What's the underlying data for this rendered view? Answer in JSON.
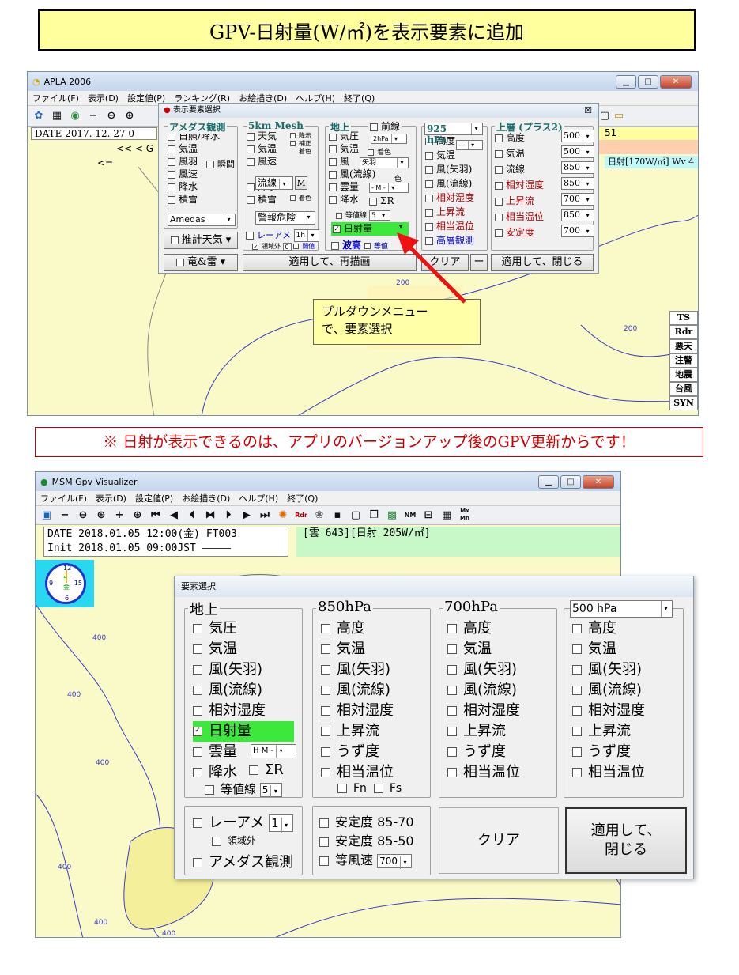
{
  "banner": {
    "text": "GPV-日射量(W/㎡)を表示要素に追加"
  },
  "notice": {
    "text": "※ 日射が表示できるのは、アプリのバージョンアップ後のGPV更新からです！"
  },
  "win1": {
    "title": "APLA 2006",
    "menu": [
      "ファイル(F)",
      "表示(D)",
      "設定値(P)",
      "ランキング(R)",
      "お絵描き(D)",
      "ヘルプ(H)",
      "終了(Q)"
    ],
    "date_text": "DATE 2017. 12. 27",
    "date_suffix": "0",
    "right_text": "51",
    "right_text2": "日射[170W/㎡] Wv 4",
    "nav1": "<< < G",
    "nav2": "<=",
    "contour": "200",
    "contour2": "200",
    "side_buttons": [
      "TS",
      "Rdr",
      "悪天",
      "注警",
      "地震",
      "台風",
      "SYN"
    ],
    "callout": "プルダウンメニュー\nで、要素選択",
    "dialog": {
      "title": "表示要素選択",
      "close": "☒",
      "amedas": {
        "legend": "アメダス観測",
        "items": [
          "日照/降水",
          "気温",
          "風羽",
          "風速",
          "降水",
          "積雪"
        ],
        "extra": "瞬間",
        "select": "Amedas"
      },
      "mesh": {
        "legend": "5km Mesh",
        "items": [
          "天気",
          "気温",
          "風速",
          "流線",
          "降水",
          "積雪"
        ],
        "notes": [
          "降示",
          "補正",
          "着色",
          "着色"
        ],
        "m_btn": "M",
        "select": "警報危険",
        "rader": "レーアメ",
        "rader_sel": "1h",
        "kiki": "領域外",
        "kiki_v": "0",
        "kiki2": "閾値"
      },
      "surface": {
        "legend": "地上",
        "sub": "前線",
        "items": [
          "気圧",
          "気温",
          "風",
          "風(流線)",
          "雲量",
          "降水"
        ],
        "pres_sel": "2hPa",
        "chakushoku": "着色",
        "wind_sel": "矢羽",
        "iro": "色",
        "cloud_sel": "- M -",
        "sigma": "ΣR",
        "contour": "等値線",
        "contour_v": "5",
        "sun": "日射量",
        "wave": "波高",
        "toukou": "等値"
      },
      "hpa925": {
        "select": "925 hPa",
        "items": [
          "高度",
          "気温",
          "風(矢羽)",
          "風(流線)",
          "相対湿度",
          "上昇流",
          "相当温位",
          "高層観測"
        ],
        "h_sel": "---"
      },
      "upper": {
        "legend": "上層 (プラス2)",
        "items": [
          "高度",
          "気温",
          "流線",
          "相対湿度",
          "上昇流",
          "相当温位",
          "安定度"
        ],
        "vals": [
          "500",
          "500",
          "850",
          "850",
          "700",
          "850",
          "700"
        ]
      },
      "b_suii": "推計天気",
      "b_tatsu": "竜&雷",
      "b_apply": "適用して、再描画",
      "b_clear": "クリア",
      "b_minus": "ー",
      "b_close": "適用して、閉じる"
    }
  },
  "win2": {
    "title": "MSM Gpv Visualizer",
    "menu": [
      "ファイル(F)",
      "表示(D)",
      "設定値(P)",
      "お絵描き(D)",
      "ヘルプ(H)",
      "終了(Q)"
    ],
    "date_line": "DATE 2018.01.05 12:00(金) FT003",
    "init_line": "Init 2018.01.05 09:00JST",
    "info": "[雲 643][日射 205W/㎡]",
    "clock_num": "15",
    "clock_day": "5",
    "clock_kanji": "金",
    "clock_top": "12",
    "clock_left": "9",
    "clock_bottom": "6",
    "contours": [
      "400",
      "400",
      "400",
      "400",
      "400",
      "400",
      "400"
    ],
    "dialog": {
      "title": "要素選択",
      "surface": {
        "legend": "地上",
        "items": [
          "気圧",
          "気温",
          "風(矢羽)",
          "風(流線)",
          "相対湿度",
          "日射量",
          "雲量",
          "降水"
        ],
        "cloud_sel": "H M -",
        "sigma": "ΣR",
        "contour": "等値線",
        "contour_v": "5"
      },
      "h850": {
        "legend": "850hPa",
        "items": [
          "高度",
          "気温",
          "風(矢羽)",
          "風(流線)",
          "相対湿度",
          "上昇流",
          "うず度",
          "相当温位"
        ],
        "fn": "Fn",
        "fs": "Fs"
      },
      "h700": {
        "legend": "700hPa",
        "items": [
          "高度",
          "気温",
          "風(矢羽)",
          "風(流線)",
          "相対湿度",
          "上昇流",
          "うず度",
          "相当温位"
        ]
      },
      "h500": {
        "select": "500 hPa",
        "items": [
          "高度",
          "気温",
          "風(矢羽)",
          "風(流線)",
          "相対湿度",
          "上昇流",
          "うず度",
          "相当温位"
        ]
      },
      "rader": "レーアメ",
      "rader_v": "1",
      "ryoiki": "領域外",
      "amedas": "アメダス観測",
      "stab1": "安定度 85-70",
      "stab2": "安定度 85-50",
      "wind": "等風速",
      "wind_v": "700",
      "clear": "クリア",
      "apply": "適用して、\n閉じる"
    }
  }
}
